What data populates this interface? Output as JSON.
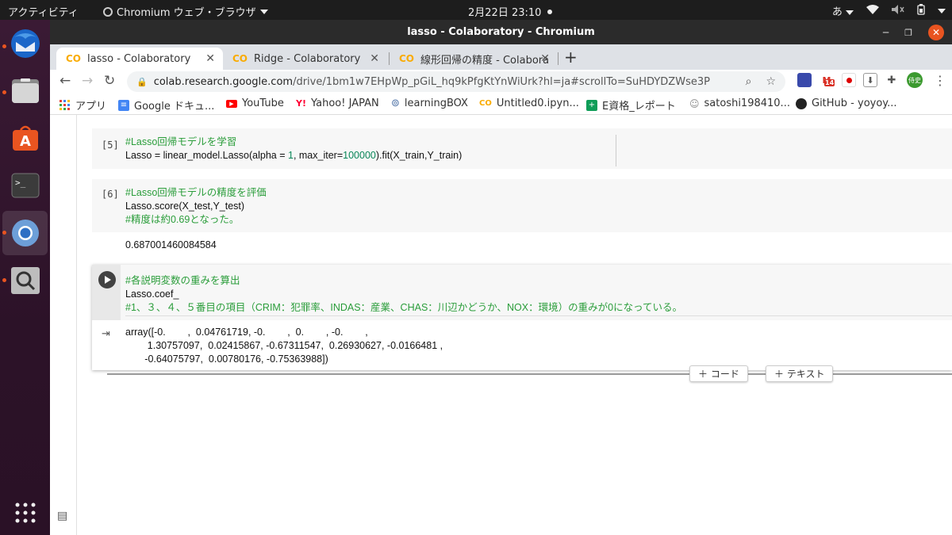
{
  "topbar": {
    "activities": "アクティビティ",
    "app": "Chromium ウェブ・ブラウザ",
    "clock": "2月22日  23:10",
    "ime": "あ"
  },
  "window": {
    "title": "lasso - Colaboratory - Chromium"
  },
  "tabs": [
    {
      "label": "lasso - Colaboratory"
    },
    {
      "label": "Ridge - Colaboratory"
    },
    {
      "label": "線形回帰の精度 - Colabora"
    }
  ],
  "omnibox": {
    "host": "colab.research.google.com",
    "path": "/drive/1bm1w7EHpWp_pGiL_hq9kPfgKtYnWiUrk?hl=ja#scrollTo=SuHDYDZWse3P"
  },
  "extensions": {
    "mail_badge": "14",
    "profile": "侍史"
  },
  "bookmarks": [
    {
      "label": "アプリ",
      "icon": "apps-grid-icon"
    },
    {
      "label": "Google ドキュ...",
      "icon": "docs-icon",
      "color": "#4285f4"
    },
    {
      "label": "YouTube",
      "icon": "youtube-icon",
      "color": "#ff0000"
    },
    {
      "label": "Yahoo! JAPAN",
      "icon": "yahoo-icon",
      "color": "#ff0033"
    },
    {
      "label": "learningBOX",
      "icon": "learningbox-icon",
      "color": "#4a6fa5"
    },
    {
      "label": "Untitled0.ipyn...",
      "icon": "colab-icon",
      "color": "#f9ab00"
    },
    {
      "label": "E資格_レポート",
      "icon": "sheets-icon",
      "color": "#0f9d58"
    },
    {
      "label": "satoshi198410...",
      "icon": "user-icon",
      "color": "#888888"
    },
    {
      "label": "GitHub - yoyoy...",
      "icon": "github-icon",
      "color": "#222222"
    }
  ],
  "cells": [
    {
      "num": "[5]",
      "comment": "#Lasso回帰モデルを学習",
      "code_a": "Lasso = linear_model.Lasso(alpha = ",
      "code_n1": "1",
      "code_b": ", max_iter=",
      "code_n2": "100000",
      "code_c": ").fit(X_train,Y_train)"
    },
    {
      "num": "[6]",
      "comment": "#Lasso回帰モデルの精度を評価",
      "code": "Lasso.score(X_test,Y_test)",
      "comment2": "#精度は約0.69となった。",
      "output": "0.687001460084584"
    },
    {
      "comment": "#各説明変数の重みを算出",
      "code": "Lasso.coef_",
      "comment2": "#1、３、４、５番目の項目（CRIM：犯罪率、INDAS：産業、CHAS：川辺かどうか、NOX：環境）の重みが0になっている。",
      "output_lines": [
        "array([-0.        ,  0.04761719, -0.        ,  0.        , -0.        ,",
        "        1.30757097,  0.02415867, -0.67311547,  0.26930627, -0.0166481 ,",
        "       -0.64075797,  0.00780176, -0.75363988])"
      ]
    }
  ],
  "add_code": "＋ コード",
  "add_text": "＋ テキスト"
}
